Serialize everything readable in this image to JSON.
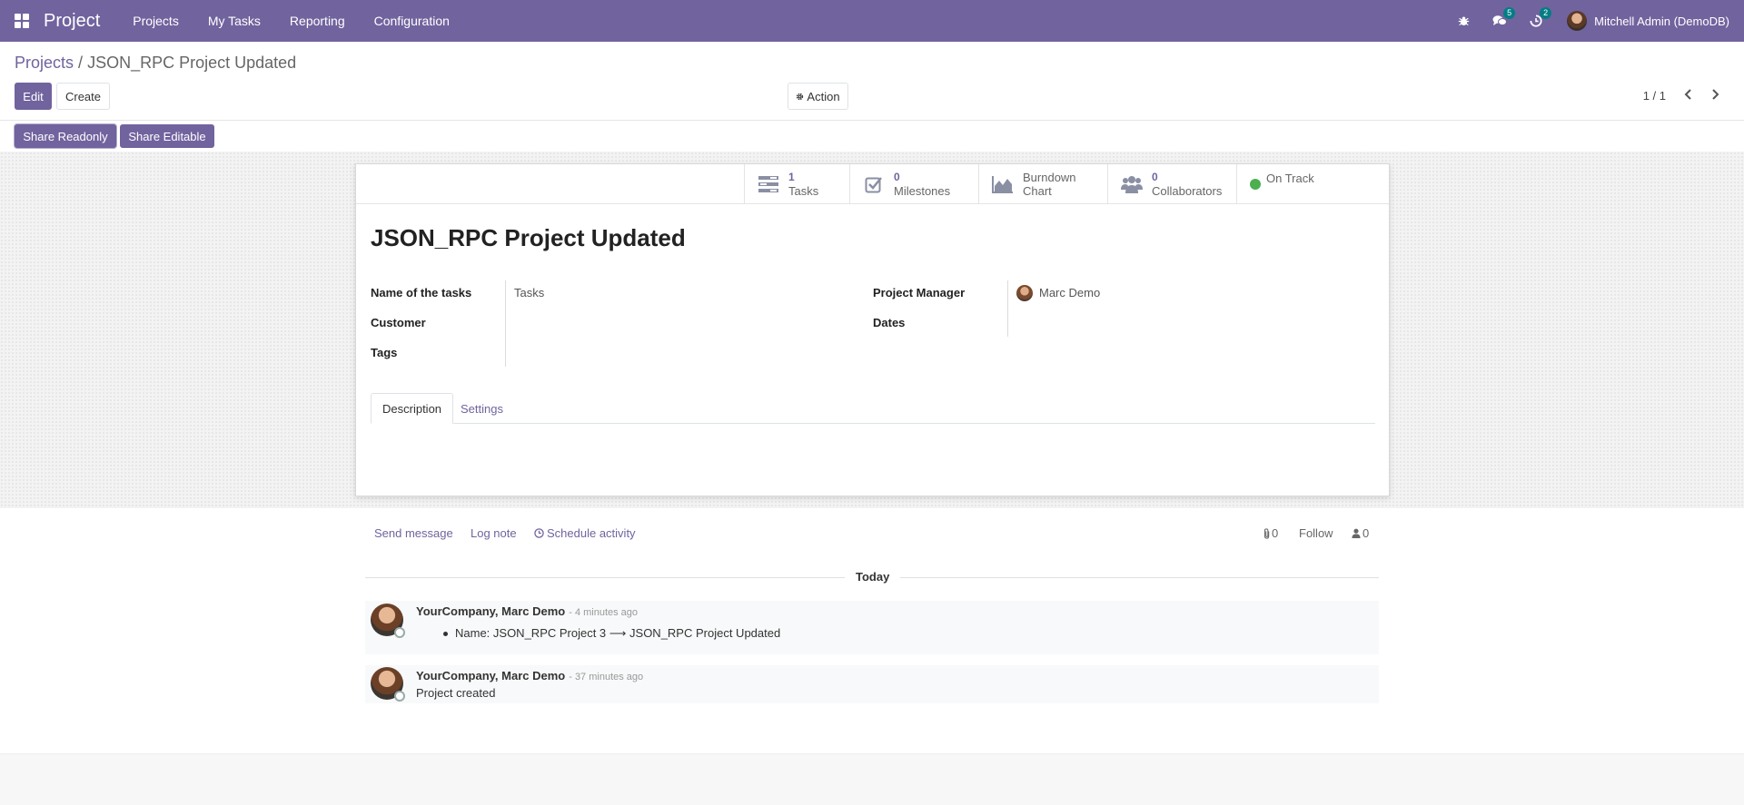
{
  "navbar": {
    "brand": "Project",
    "menu": [
      "Projects",
      "My Tasks",
      "Reporting",
      "Configuration"
    ],
    "messages_count": "5",
    "activities_count": "2",
    "user_name": "Mitchell Admin (DemoDB)"
  },
  "breadcrumb": {
    "parent": "Projects",
    "separator": "/",
    "current": "JSON_RPC Project Updated"
  },
  "buttons": {
    "edit": "Edit",
    "create": "Create",
    "action": "Action",
    "share_readonly": "Share Readonly",
    "share_editable": "Share Editable"
  },
  "pager": {
    "value": "1 / 1"
  },
  "stats": {
    "tasks": {
      "count": "1",
      "label": "Tasks"
    },
    "milestones": {
      "count": "0",
      "label": "Milestones"
    },
    "burndown": {
      "line1": "Burndown",
      "line2": "Chart"
    },
    "collaborators": {
      "count": "0",
      "label": "Collaborators"
    },
    "status": "On Track"
  },
  "record": {
    "title": "JSON_RPC Project Updated",
    "fields": {
      "tasks_name_label": "Name of the tasks",
      "tasks_name_value": "Tasks",
      "customer_label": "Customer",
      "tags_label": "Tags",
      "manager_label": "Project Manager",
      "manager_value": "Marc Demo",
      "dates_label": "Dates"
    },
    "tabs": [
      "Description",
      "Settings"
    ]
  },
  "chatter": {
    "send_message": "Send message",
    "log_note": "Log note",
    "schedule_activity": "Schedule activity",
    "attachments_count": "0",
    "follow": "Follow",
    "followers_count": "0",
    "day_label": "Today",
    "messages": [
      {
        "author": "YourCompany, Marc Demo",
        "time": "- 4 minutes ago",
        "body": "Name: JSON_RPC Project 3 ⟶ JSON_RPC Project Updated"
      },
      {
        "author": "YourCompany, Marc Demo",
        "time": "- 37 minutes ago",
        "body": "Project created"
      }
    ]
  },
  "colors": {
    "brand": "#71639e",
    "status_on_track": "#4caf50",
    "badge": "#017e84"
  }
}
